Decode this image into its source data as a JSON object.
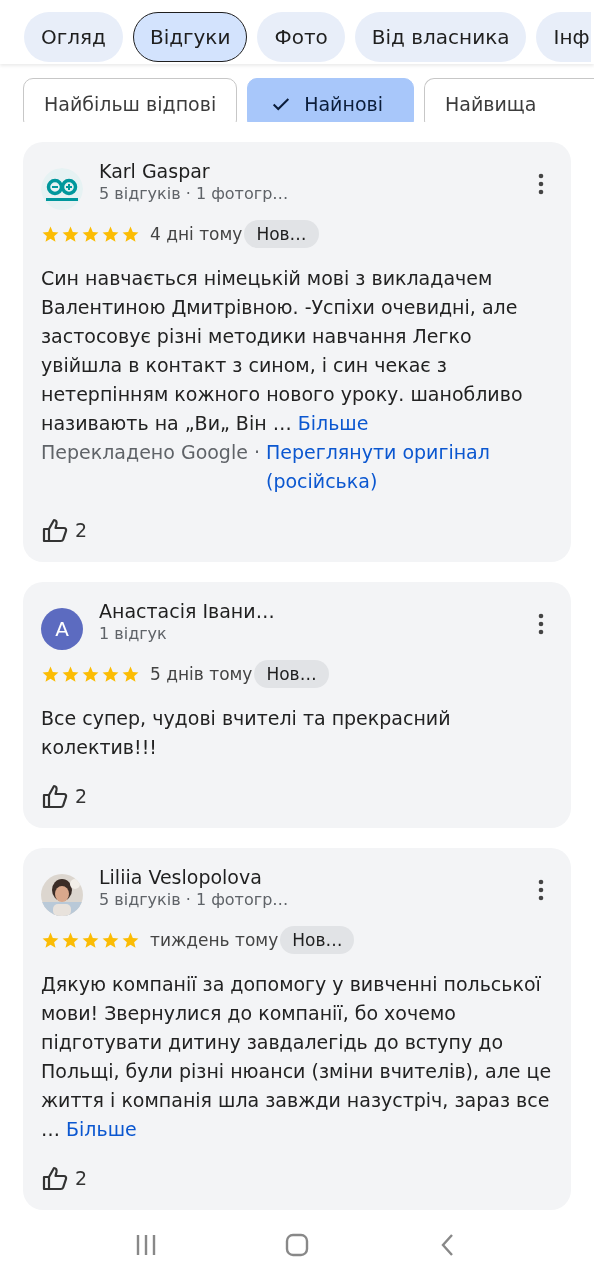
{
  "tabs": [
    {
      "label": "Огляд",
      "selected": false
    },
    {
      "label": "Відгуки",
      "selected": true
    },
    {
      "label": "Фото",
      "selected": false
    },
    {
      "label": "Від власника",
      "selected": false
    },
    {
      "label": "Інф",
      "selected": false
    }
  ],
  "filters": [
    {
      "label": "Найбільш відпові",
      "selected": false
    },
    {
      "label": "Найнові",
      "selected": true
    },
    {
      "label": "Найвища",
      "selected": false
    }
  ],
  "reviews": [
    {
      "author": "Karl Gaspar",
      "meta": "5 відгуків · 1 фотогр…",
      "avatar": {
        "kind": "logo"
      },
      "stars": 5,
      "time": "4 дні тому",
      "badge": "Нов…",
      "text": "Син навчається німецькій мові з викладачем Валентиною Дмитрівною. -Успіхи очевидні, але застосовує різні методики навчання Легко увійшла в контакт з сином, і син чекає з нетерпінням кожного нового уроку. шанобливо називають на „Ви„ Він …",
      "more": "Більше",
      "translation": {
        "note": "Перекладено Google ·",
        "link": "Переглянути оригінал (російська)"
      },
      "likes": "2"
    },
    {
      "author": "Анастасія Івани…",
      "meta": "1 відгук",
      "avatar": {
        "kind": "letter",
        "letter": "A",
        "color": "#5c6bc0"
      },
      "stars": 5,
      "time": "5 днів тому",
      "badge": "Нов…",
      "text": "Все супер, чудові вчителі та прекрасний колектив!!!",
      "likes": "2"
    },
    {
      "author": "Liliia Veslopolova",
      "meta": "5 відгуків · 1 фотогр…",
      "stars": 5,
      "time": "тиждень тому",
      "badge": "Нов…",
      "text": "Дякую компанії за допомогу у вивченні польської мови! Звернулися до компанії, бо хочемо підготувати дитину завдалегідь до вступу до Польщі, були різні нюанси (зміни вчителів), але це життя і компанія шла завжди назустріч, зараз все …",
      "more": "Більше",
      "likes": "2"
    }
  ]
}
